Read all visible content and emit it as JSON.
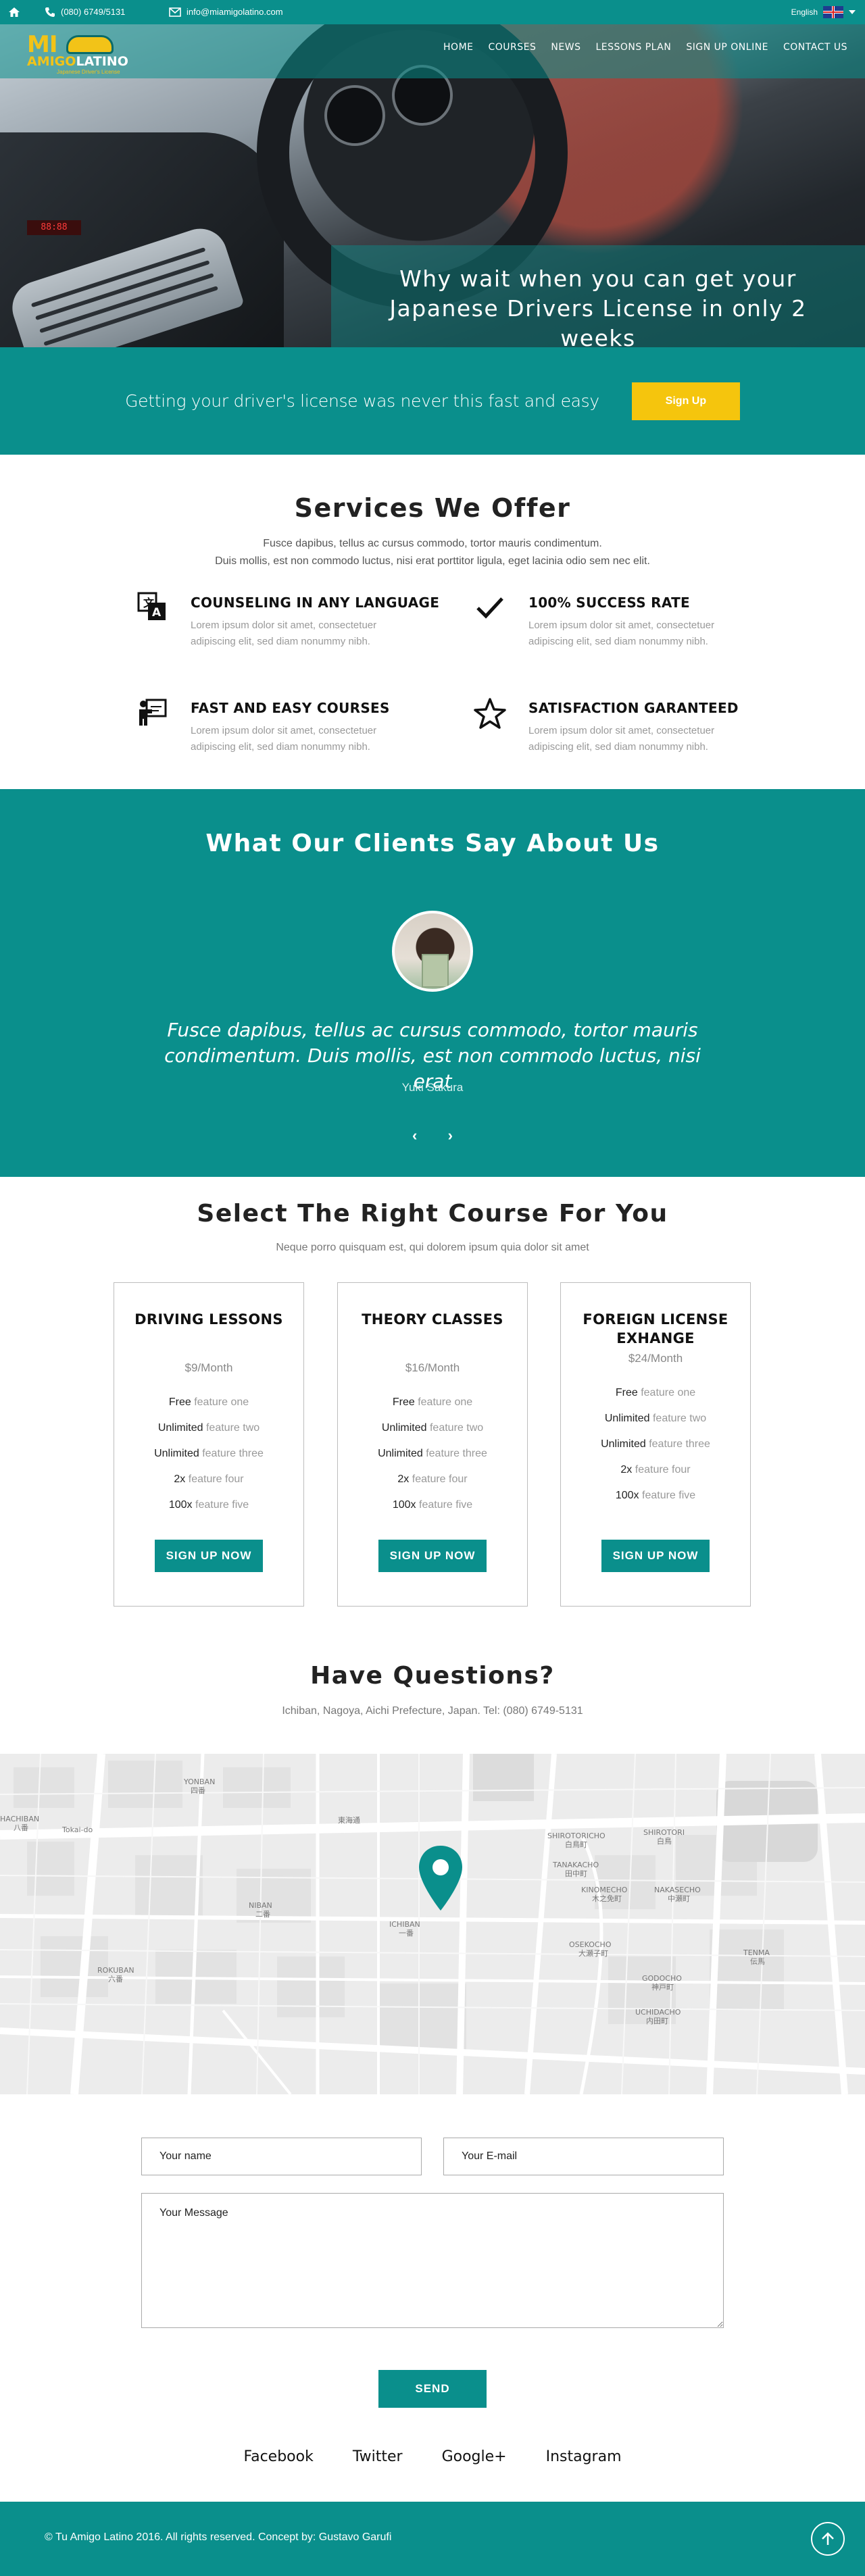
{
  "topbar": {
    "phone": "(080) 6749/5131",
    "email": "info@miamigolatino.com",
    "language": "English"
  },
  "logo": {
    "line1": "MI",
    "line2a": "AMIGO",
    "line2b": "LATINO",
    "tagline": "Japanese Driver's License"
  },
  "nav": [
    "HOME",
    "COURSES",
    "NEWS",
    "LESSONS PLAN",
    "SIGN UP ONLINE",
    "CONTACT US"
  ],
  "hero": {
    "headline": "Why wait when you can get your Japanese Drivers License in only 2 weeks"
  },
  "cta": {
    "text": "Getting your driver's license was never this fast and easy",
    "button": "Sign Up"
  },
  "services": {
    "title": "Services We Offer",
    "subtitle_line1": "Fusce dapibus, tellus ac cursus commodo, tortor mauris condimentum.",
    "subtitle_line2": "Duis mollis, est non commodo luctus, nisi erat porttitor ligula, eget lacinia odio sem nec elit.",
    "items": [
      {
        "title": "COUNSELING IN ANY LANGUAGE",
        "text": "Lorem ipsum dolor sit amet, consectetuer adipiscing elit, sed diam nonummy nibh.",
        "icon": "translate-icon"
      },
      {
        "title": "100% SUCCESS RATE",
        "text": "Lorem ipsum dolor sit amet, consectetuer adipiscing elit, sed diam nonummy nibh.",
        "icon": "checkmark-icon"
      },
      {
        "title": "FAST AND EASY COURSES",
        "text": "Lorem ipsum dolor sit amet, consectetuer adipiscing elit, sed diam nonummy nibh.",
        "icon": "teacher-icon"
      },
      {
        "title": "SATISFACTION GARANTEED",
        "text": "Lorem ipsum dolor sit amet, consectetuer adipiscing elit, sed diam nonummy nibh.",
        "icon": "star-icon"
      }
    ]
  },
  "testimonials": {
    "title": "What Our Clients Say About Us",
    "quote": "Fusce dapibus, tellus ac cursus commodo, tortor mauris condimentum. Duis mollis, est non commodo luctus, nisi erat",
    "author": "Yuki Sakura"
  },
  "pricing": {
    "title": "Select The Right Course For You",
    "subtitle": "Neque porro quisquam est, qui dolorem ipsum quia dolor sit amet",
    "plans": [
      {
        "name": "DRIVING LESSONS",
        "price": "$9/Month",
        "button": "SIGN UP NOW",
        "features": [
          [
            "Free",
            "feature one"
          ],
          [
            "Unlimited",
            "feature two"
          ],
          [
            "Unlimited",
            "feature three"
          ],
          [
            "2x",
            "feature four"
          ],
          [
            "100x",
            "feature five"
          ]
        ]
      },
      {
        "name": "THEORY CLASSES",
        "price": "$16/Month",
        "button": "SIGN UP NOW",
        "features": [
          [
            "Free",
            "feature one"
          ],
          [
            "Unlimited",
            "feature two"
          ],
          [
            "Unlimited",
            "feature three"
          ],
          [
            "2x",
            "feature four"
          ],
          [
            "100x",
            "feature five"
          ]
        ]
      },
      {
        "name": "FOREIGN LICENSE EXHANGE",
        "price": "$24/Month",
        "button": "SIGN UP NOW",
        "features": [
          [
            "Free",
            "feature one"
          ],
          [
            "Unlimited",
            "feature two"
          ],
          [
            "Unlimited",
            "feature three"
          ],
          [
            "2x",
            "feature four"
          ],
          [
            "100x",
            "feature five"
          ]
        ]
      }
    ]
  },
  "contact": {
    "title": "Have Questions?",
    "address": "Ichiban, Nagoya, Aichi Prefecture, Japan. Tel: (080) 6749-5131",
    "name_placeholder": "Your name",
    "email_placeholder": "Your E-mail",
    "message_placeholder": "Your Message",
    "send": "SEND"
  },
  "map": {
    "labels": [
      {
        "en": "YONBAN",
        "jp": "四番"
      },
      {
        "en": "NIBAN",
        "jp": "二番"
      },
      {
        "en": "ICHIBAN",
        "jp": "一番"
      },
      {
        "en": "ROKUBAN",
        "jp": "六番"
      },
      {
        "en": "SHIROTORICHO",
        "jp": "白鳥町"
      },
      {
        "en": "SHIROTORI",
        "jp": "白鳥"
      },
      {
        "en": "TANAKACHO",
        "jp": "田中町"
      },
      {
        "en": "KINOMECHO",
        "jp": "木之免町"
      },
      {
        "en": "NAKASECHO",
        "jp": "中瀬町"
      },
      {
        "en": "OSEKOCHO",
        "jp": "大瀬子町"
      },
      {
        "en": "GODOCHO",
        "jp": "神戸町"
      },
      {
        "en": "UCHIDACHO",
        "jp": "内田町"
      },
      {
        "en": "TENMA",
        "jp": "伝馬"
      },
      {
        "en": "HACHIBAN",
        "jp": "八番"
      }
    ],
    "road_label": "東海通",
    "street_label": "Tokai-do"
  },
  "socials": [
    "Facebook",
    "Twitter",
    "Google+",
    "Instagram"
  ],
  "footer": {
    "copyright": "© Tu Amigo Latino 2016. All rights reserved. Concept by: Gustavo Garufi"
  },
  "colors": {
    "teal": "#0a8f8c",
    "yellow": "#f5c50d"
  }
}
